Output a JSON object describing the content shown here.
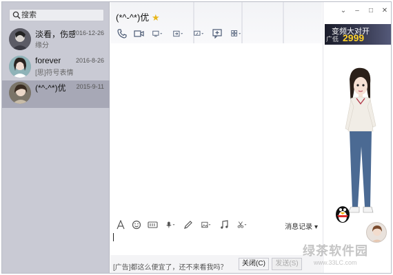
{
  "sidebar": {
    "search_label": "搜索",
    "contacts": [
      {
        "name": "淡看，伤感",
        "date": "2016-12-26",
        "sub": "缘分"
      },
      {
        "name": "forever",
        "date": "2016-8-26",
        "sub": "[思]符号表情"
      },
      {
        "name": "(*^-^*)优",
        "date": "2015-9-11",
        "sub": ""
      }
    ]
  },
  "chat": {
    "title": "(*^-^*)优",
    "history_label": "消息记录",
    "ad_text": "[广告]都这么便宜了，还不来看我吗？",
    "close_button": "关闭(C)",
    "send_button": "发送(S)"
  },
  "right_panel": {
    "banner_line1": "变频大对开",
    "banner_label": "广低",
    "banner_price": "2999",
    "watermark": "绿茶软件园",
    "watermark_url": "www.33LC.com"
  },
  "colors": {
    "sidebar_bg": "#c9cad4",
    "active_row": "#a7a8b6",
    "star": "#e8b61a",
    "banner_price": "#ffd22a"
  }
}
